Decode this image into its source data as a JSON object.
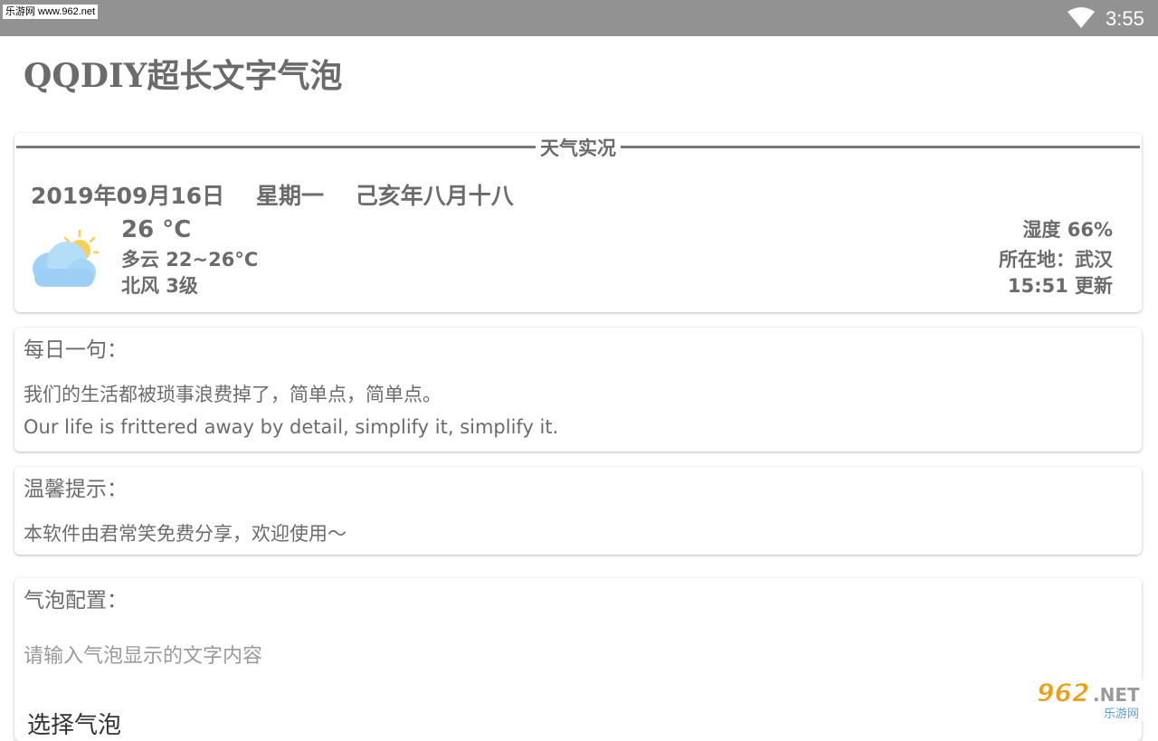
{
  "status_bar": {
    "watermark": "乐游网 www.962.net",
    "time": "3:55",
    "wifi_icon": "wifi-icon"
  },
  "app": {
    "title": "QQDIY超长文字气泡"
  },
  "weather": {
    "section_title": "天气实况",
    "date_line": "2019年09月16日    星期一    己亥年八月十八",
    "temperature": "26 °C",
    "condition_range": "多云 22~26°C",
    "wind": "北风 3级",
    "humidity": "湿度 66%",
    "location": "所在地：武汉",
    "updated": "15:51 更新",
    "icon": "partly-cloudy-icon"
  },
  "daily_quote": {
    "heading": "每日一句：",
    "chinese": "我们的生活都被琐事浪费掉了，简单点，简单点。",
    "english": "Our life is frittered away by detail, simplify it, simplify it."
  },
  "tips": {
    "heading": "温馨提示：",
    "text": "本软件由君常笑免费分享，欢迎使用～"
  },
  "bubble_config": {
    "heading": "气泡配置：",
    "input_placeholder": "请输入气泡显示的文字内容",
    "select_label": "选择气泡"
  },
  "logo": {
    "main": "962.NET",
    "sub": "乐游网"
  }
}
